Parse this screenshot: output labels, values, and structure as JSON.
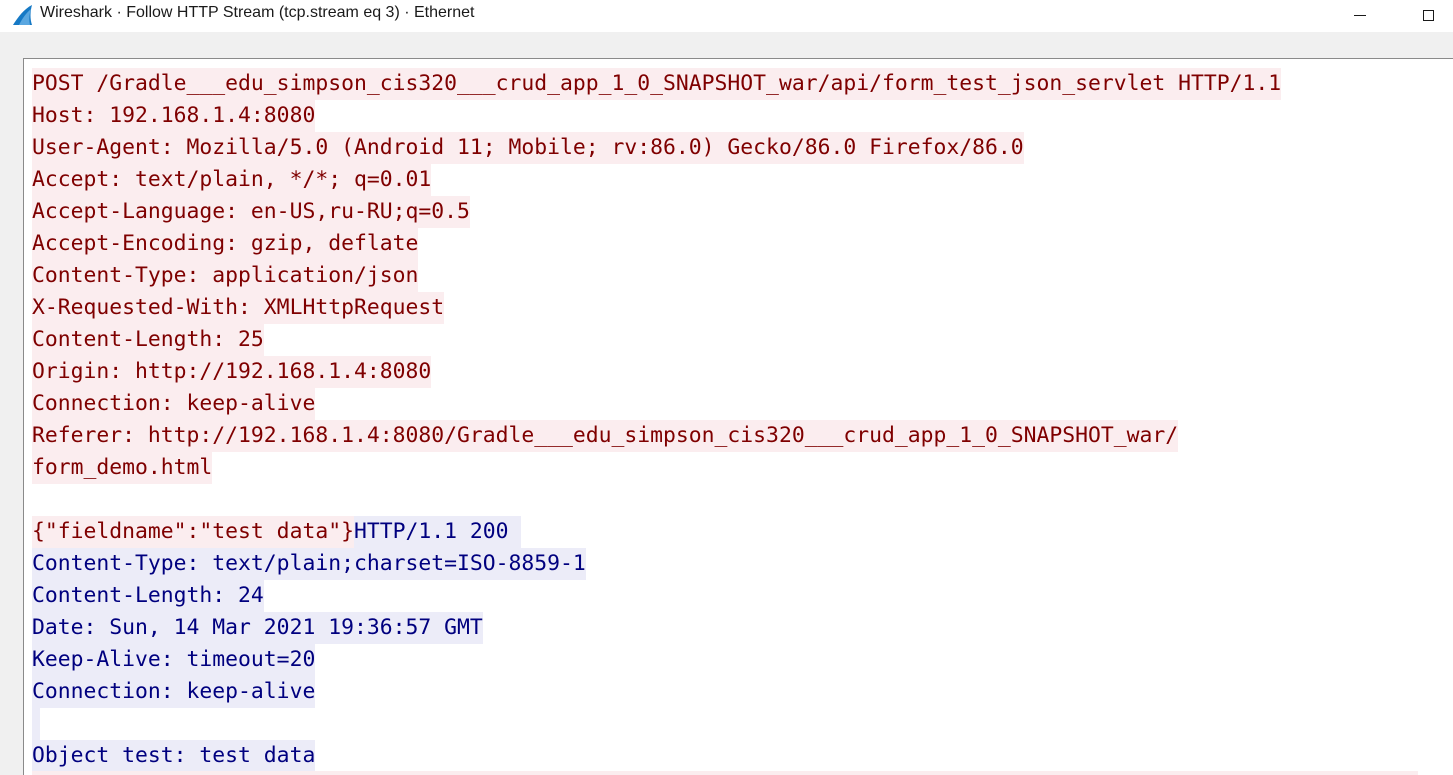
{
  "window": {
    "title": "Wireshark · Follow HTTP Stream (tcp.stream eq 3) · Ethernet",
    "app_icon": "wireshark-fin-icon",
    "minimize_icon": "minimize-icon",
    "maximize_icon": "maximize-icon"
  },
  "colors": {
    "client_text": "#7f0000",
    "client_bg": "#fbedef",
    "server_text": "#00007f",
    "server_bg": "#ececf8"
  },
  "stream": {
    "lines": [
      {
        "segments": [
          {
            "text": "POST /Gradle___edu_simpson_cis320___crud_app_1_0_SNAPSHOT_war/api/form_test_json_servlet HTTP/1.1",
            "side": "client"
          }
        ]
      },
      {
        "segments": [
          {
            "text": "Host: 192.168.1.4:8080",
            "side": "client"
          }
        ]
      },
      {
        "segments": [
          {
            "text": "User-Agent: Mozilla/5.0 (Android 11; Mobile; rv:86.0) Gecko/86.0 Firefox/86.0",
            "side": "client"
          }
        ]
      },
      {
        "segments": [
          {
            "text": "Accept: text/plain, */*; q=0.01",
            "side": "client"
          }
        ]
      },
      {
        "segments": [
          {
            "text": "Accept-Language: en-US,ru-RU;q=0.5",
            "side": "client"
          }
        ]
      },
      {
        "segments": [
          {
            "text": "Accept-Encoding: gzip, deflate",
            "side": "client"
          }
        ]
      },
      {
        "segments": [
          {
            "text": "Content-Type: application/json",
            "side": "client"
          }
        ]
      },
      {
        "segments": [
          {
            "text": "X-Requested-With: XMLHttpRequest",
            "side": "client"
          }
        ]
      },
      {
        "segments": [
          {
            "text": "Content-Length: 25",
            "side": "client"
          }
        ]
      },
      {
        "segments": [
          {
            "text": "Origin: http://192.168.1.4:8080",
            "side": "client"
          }
        ]
      },
      {
        "segments": [
          {
            "text": "Connection: keep-alive",
            "side": "client"
          }
        ]
      },
      {
        "segments": [
          {
            "text": "Referer: http://192.168.1.4:8080/Gradle___edu_simpson_cis320___crud_app_1_0_SNAPSHOT_war/",
            "side": "client"
          }
        ]
      },
      {
        "segments": [
          {
            "text": "form_demo.html",
            "side": "client"
          }
        ]
      },
      {
        "segments": []
      },
      {
        "segments": [
          {
            "text": "{\"fieldname\":\"test data\"}",
            "side": "client"
          },
          {
            "text": "HTTP/1.1 200 ",
            "side": "server"
          }
        ]
      },
      {
        "segments": [
          {
            "text": "Content-Type: text/plain;charset=ISO-8859-1",
            "side": "server"
          }
        ]
      },
      {
        "segments": [
          {
            "text": "Content-Length: 24",
            "side": "server"
          }
        ]
      },
      {
        "segments": [
          {
            "text": "Date: Sun, 14 Mar 2021 19:36:57 GMT",
            "side": "server"
          }
        ]
      },
      {
        "segments": [
          {
            "text": "Keep-Alive: timeout=20",
            "side": "server"
          }
        ]
      },
      {
        "segments": [
          {
            "text": "Connection: keep-alive",
            "side": "server"
          }
        ]
      },
      {
        "segments": [
          {
            "text": "",
            "side": "server"
          }
        ]
      },
      {
        "segments": [
          {
            "text": "Object test: test data",
            "side": "server"
          }
        ]
      }
    ]
  }
}
